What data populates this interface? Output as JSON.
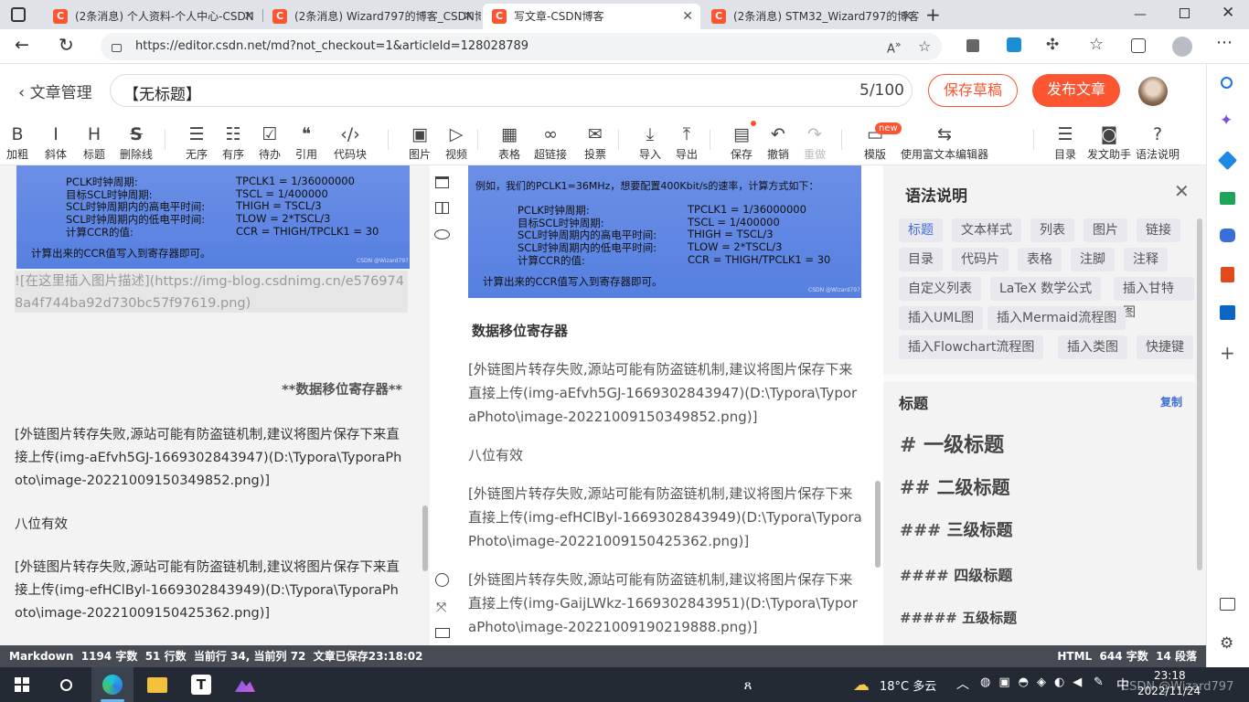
{
  "browser": {
    "tabs": [
      {
        "title": "(2条消息) 个人资料-个人中心-CSDN",
        "active": false
      },
      {
        "title": "(2条消息) Wizard797的博客_CSDN博客",
        "active": false
      },
      {
        "title": "写文章-CSDN博客",
        "active": true
      },
      {
        "title": "(2条消息) STM32_Wizard797的博客",
        "active": false
      }
    ],
    "favicon_letter": "C",
    "url": "https://editor.csdn.net/md?not_checkout=1&articleId=128028789",
    "colors": {
      "brand": "#fc5531",
      "tabbar": "#dfe3e8"
    }
  },
  "header": {
    "back_label": "文章管理",
    "title": "【无标题】",
    "count": "5/100",
    "save_draft": "保存草稿",
    "publish": "发布文章"
  },
  "toolbar": {
    "items": [
      {
        "label": "加粗",
        "icon": "bold-icon",
        "glyph": "B"
      },
      {
        "label": "斜体",
        "icon": "italic-icon",
        "glyph": "I"
      },
      {
        "label": "标题",
        "icon": "heading-icon",
        "glyph": "H"
      },
      {
        "label": "删除线",
        "icon": "strikethrough-icon",
        "glyph": "S"
      },
      {
        "label": "无序",
        "icon": "unordered-list-icon",
        "glyph": "☰"
      },
      {
        "label": "有序",
        "icon": "ordered-list-icon",
        "glyph": "☷"
      },
      {
        "label": "待办",
        "icon": "todo-list-icon",
        "glyph": "☑"
      },
      {
        "label": "引用",
        "icon": "quote-icon",
        "glyph": "❝"
      },
      {
        "label": "代码块",
        "icon": "code-block-icon",
        "glyph": "‹/›"
      },
      {
        "label": "图片",
        "icon": "image-icon",
        "glyph": "▣"
      },
      {
        "label": "视频",
        "icon": "video-icon",
        "glyph": "▷"
      },
      {
        "label": "表格",
        "icon": "table-icon",
        "glyph": "▦"
      },
      {
        "label": "超链接",
        "icon": "link-icon",
        "glyph": "∞"
      },
      {
        "label": "投票",
        "icon": "vote-icon",
        "glyph": "✉"
      },
      {
        "label": "导入",
        "icon": "import-icon",
        "glyph": "⤓"
      },
      {
        "label": "导出",
        "icon": "export-icon",
        "glyph": "⤒"
      },
      {
        "label": "保存",
        "icon": "save-icon",
        "glyph": "▤"
      },
      {
        "label": "撤销",
        "icon": "undo-icon",
        "glyph": "↶"
      },
      {
        "label": "重做",
        "icon": "redo-icon",
        "glyph": "↷"
      },
      {
        "label": "模版",
        "icon": "template-icon",
        "glyph": "▭"
      },
      {
        "label": "使用富文本编辑器",
        "icon": "switch-editor-icon",
        "glyph": "⇆"
      },
      {
        "label": "目录",
        "icon": "toc-icon",
        "glyph": "☰"
      },
      {
        "label": "发文助手",
        "icon": "assistant-icon",
        "glyph": "◙"
      },
      {
        "label": "语法说明",
        "icon": "help-icon",
        "glyph": "?"
      }
    ],
    "badge_new": "new"
  },
  "left_editor": {
    "image": {
      "rows": [
        {
          "k": "PCLK时钟周期:",
          "v": "TPCLK1 = 1/36000000"
        },
        {
          "k": "目标SCL时钟周期:",
          "v": "TSCL = 1/400000"
        },
        {
          "k": "SCL时钟周期内的高电平时间:",
          "v": "THIGH = TSCL/3"
        },
        {
          "k": "SCL时钟周期内的低电平时间:",
          "v": "TLOW = 2*TSCL/3"
        },
        {
          "k": "计算CCR的值:",
          "v": "CCR   = THIGH/TPCLK1  = 30"
        }
      ],
      "footer": "计算出来的CCR值写入到寄存器即可。",
      "watermark": "CSDN @Wizard797"
    },
    "img_markdown": "![在这里插入图片描述](https://img-blog.csdnimg.cn/e5769748a4f744ba92d730bc57f97619.png)",
    "bold_heading": "**数据移位寄存器**",
    "para1": "[外链图片转存失败,源站可能有防盗链机制,建议将图片保存下来直接上传(img-aEfvh5GJ-1669302843947)(D:\\Typora\\TyporaPhoto\\image-20221009150349852.png)]",
    "para2": "八位有效",
    "para3": "[外链图片转存失败,源站可能有防盗链机制,建议将图片保存下来直接上传(img-efHClByl-1669302843949)(D:\\Typora\\TyporaPhoto\\image-20221009150425362.png)]"
  },
  "preview": {
    "image": {
      "intro": "例如，我们的PCLK1=36MHz，想要配置400Kbit/s的速率，计算方式如下：",
      "rows": [
        {
          "k": "PCLK时钟周期:",
          "v": "TPCLK1 = 1/36000000"
        },
        {
          "k": "目标SCL时钟周期:",
          "v": "TSCL = 1/400000"
        },
        {
          "k": "SCL时钟周期内的高电平时间:",
          "v": "THIGH = TSCL/3"
        },
        {
          "k": "SCL时钟周期内的低电平时间:",
          "v": "TLOW = 2*TSCL/3"
        },
        {
          "k": "计算CCR的值:",
          "v": "CCR   = THIGH/TPCLK1  = 30"
        }
      ],
      "footer": "计算出来的CCR值写入到寄存器即可。",
      "watermark": "CSDN @Wizard797"
    },
    "heading": "数据移位寄存器",
    "para1": "[外链图片转存失败,源站可能有防盗链机制,建议将图片保存下来直接上传(img-aEfvh5GJ-1669302843947)(D:\\Typora\\TyporaPhoto\\image-20221009150349852.png)]",
    "para2": "八位有效",
    "para3": "[外链图片转存失败,源站可能有防盗链机制,建议将图片保存下来直接上传(img-efHClByl-1669302843949)(D:\\Typora\\TyporaPhoto\\image-20221009150425362.png)]",
    "para4": "[外链图片转存失败,源站可能有防盗链机制,建议将图片保存下来直接上传(img-GaijLWkz-1669302843951)(D:\\Typora\\TyporaPhoto\\image-20221009190219888.png)]"
  },
  "syntax_panel": {
    "title": "语法说明",
    "chips": [
      "标题",
      "文本样式",
      "列表",
      "图片",
      "链接",
      "目录",
      "代码片",
      "表格",
      "注脚",
      "注释",
      "自定义列表",
      "LaTeX 数学公式",
      "插入甘特图",
      "插入UML图",
      "插入Mermaid流程图",
      "插入Flowchart流程图",
      "插入类图",
      "快捷键"
    ],
    "selected_chip": "标题",
    "section_title": "标题",
    "copy_label": "复制",
    "headings": [
      {
        "hash": "#",
        "text": "一级标题"
      },
      {
        "hash": "##",
        "text": "二级标题"
      },
      {
        "hash": "###",
        "text": "三级标题"
      },
      {
        "hash": "####",
        "text": "四级标题"
      },
      {
        "hash": "#####",
        "text": "五级标题"
      }
    ]
  },
  "status": {
    "left": "Markdown  1194 字数  51 行数  当前行 34, 当前列 72  文章已保存23:18:02",
    "right": "HTML  644 字数  14 段落"
  },
  "taskbar": {
    "weather": "18°C 多云",
    "ime": "中",
    "time": "23:18",
    "date": "2022/11/24",
    "watermark": "CSDN @Wizard797"
  }
}
